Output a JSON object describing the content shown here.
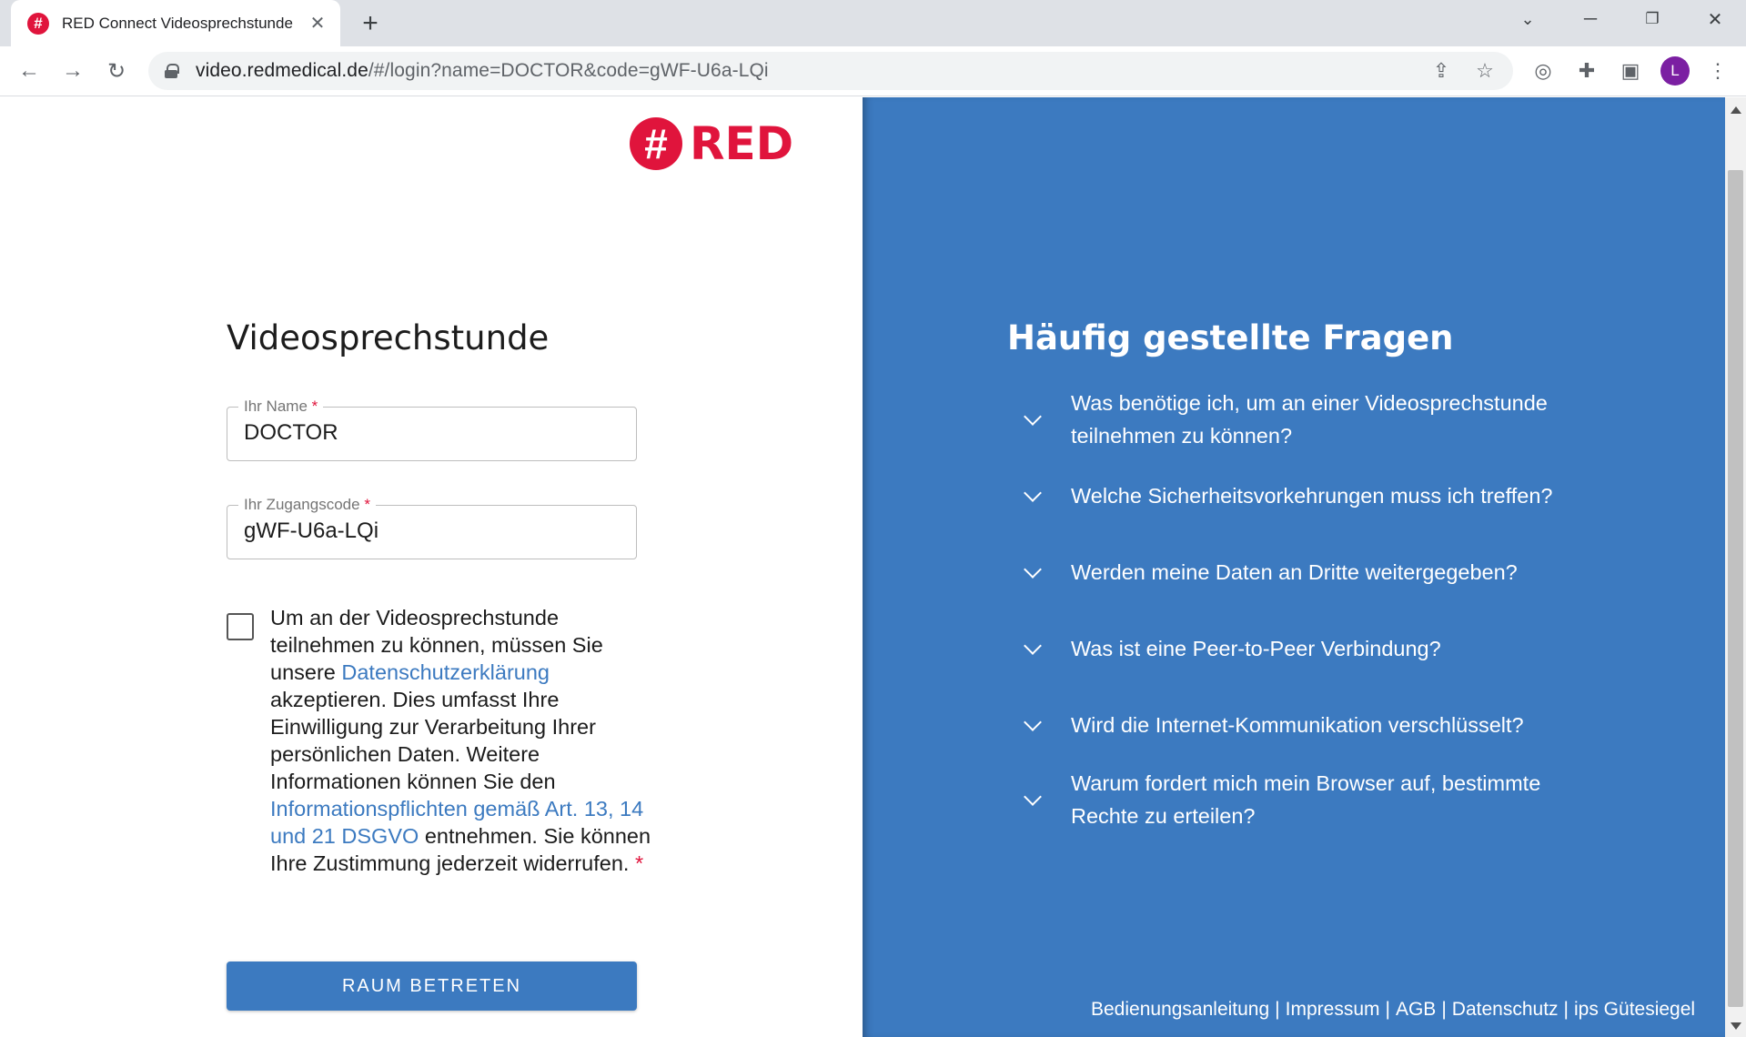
{
  "browser": {
    "tab_title": "RED Connect Videosprechstunde",
    "tab_favicon": "#",
    "url_host": "video.redmedical.de",
    "url_path": "/#/login?name=DOCTOR&code=gWF-U6a-LQi",
    "profile_initial": "L"
  },
  "logo": {
    "symbol": "#",
    "text": "RED"
  },
  "form": {
    "title": "Videosprechstunde",
    "name_label": "Ihr Name",
    "name_value": "DOCTOR",
    "code_label": "Ihr Zugangscode",
    "code_value": "gWF-U6a-LQi",
    "required_mark": "*",
    "consent": {
      "part1": "Um an der Videosprechstunde teilnehmen zu können, müssen Sie unsere ",
      "link1": "Datenschutzerklärung",
      "part2": " akzeptieren. Dies umfasst Ihre Einwilligung zur Verarbeitung Ihrer persönlichen Daten. Weitere Informationen können Sie den ",
      "link2": "Informationspflichten gemäß Art. 13, 14 und 21 DSGVO",
      "part3": " entnehmen. Sie können Ihre Zustimmung jederzeit widerrufen. ",
      "checked": false
    },
    "submit_label": "RAUM BETRETEN"
  },
  "faq": {
    "title": "Häufig gestellte Fragen",
    "items": [
      "Was benötige ich, um an einer Videosprechstunde teilnehmen zu können?",
      "Welche Sicherheitsvorkehrungen muss ich treffen?",
      "Werden meine Daten an Dritte weitergegeben?",
      "Was ist eine Peer-to-Peer Verbindung?",
      "Wird die Internet-Kommunikation verschlüsselt?",
      "Warum fordert mich mein Browser auf, bestimmte Rechte zu erteilen?"
    ]
  },
  "footer": {
    "links": [
      "Bedienungsanleitung",
      "Impressum",
      "AGB",
      "Datenschutz",
      "ips Gütesiegel"
    ],
    "separator": "|"
  },
  "colors": {
    "brand_red": "#e0143c",
    "brand_blue": "#3c7ac0"
  }
}
